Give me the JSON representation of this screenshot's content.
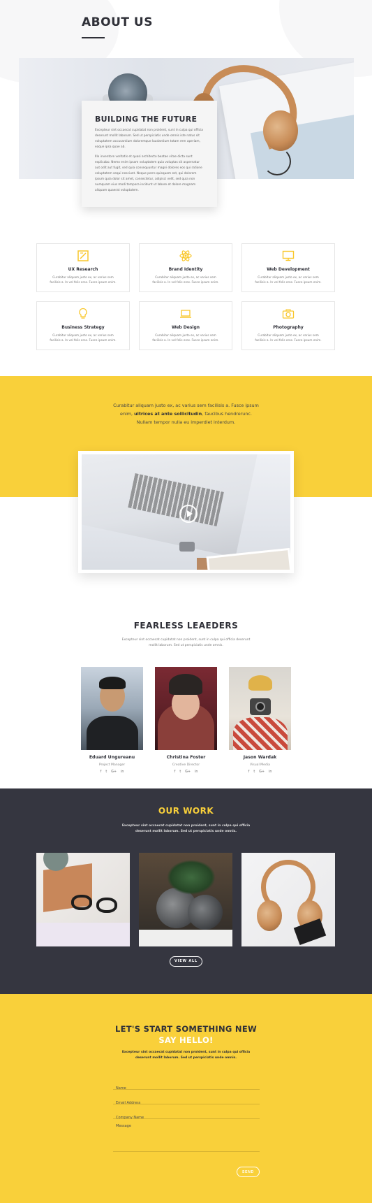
{
  "hero": {
    "title": "ABOUT US"
  },
  "intro_card": {
    "title": "BUILDING THE FUTURE",
    "paragraph1": "Excepteur sint occaecat cupidatat non proident, sunt in culpa qui officia deserunt mollit laborum. Sed ut perspiciatis unde omnis iste natus sit voluptatem accusantium doloremque laudantium totam rem aperiam, eaque ipsa quae ab.",
    "paragraph2": "Illo inventore veritatis et quasi architecto beatae vitae dicta sunt explicabo. Nemo enim ipsam voluptatem quia voluptas sit aspernatur aut odit aut fugit, sed quia consequuntur magni dolores eos qui ratione voluptatem sequi nesciunt. Neque porro quisquam est, qui dolorem ipsum quia dolor sit amet, consectetur, adipisci velit, sed quia non numquam eius modi tempora incidunt ut labore et dolore magnam aliquam quaerat voluptatem."
  },
  "services": [
    {
      "title": "UX Research",
      "text": "Curabitur aliquam justo ex, ac varius sem facilisis a. In vel felis eros. Fusce ipsum enim.",
      "icon": "pencil-square-icon"
    },
    {
      "title": "Brand Identity",
      "text": "Curabitur aliquam justo ex, ac varius sem facilisis a. In vel felis eros. Fusce ipsum enim.",
      "icon": "atom-icon"
    },
    {
      "title": "Web Development",
      "text": "Curabitur aliquam justo ex, ac varius sem facilisis a. In vel felis eros. Fusce ipsum enim.",
      "icon": "monitor-icon"
    },
    {
      "title": "Business Strategy",
      "text": "Curabitur aliquam justo ex, ac varius sem facilisis a. In vel felis eros. Fusce ipsum enim.",
      "icon": "lightbulb-icon"
    },
    {
      "title": "Web Design",
      "text": "Curabitur aliquam justo ex, ac varius sem facilisis a. In vel felis eros. Fusce ipsum enim.",
      "icon": "laptop-icon"
    },
    {
      "title": "Photography",
      "text": "Curabitur aliquam justo ex, ac varius sem facilisis a. In vel felis eros. Fusce ipsum enim.",
      "icon": "camera-icon"
    }
  ],
  "quote": {
    "part1": "Curabitur aliquam justo ex, ac varius sem facilisis a. Fusce ipsum enim, ",
    "bold": "ultrices at ante sollicitudin",
    "part2": ", faucibus hendrerunc. Nullam tempor nulla eu imperdiet interdum."
  },
  "team": {
    "title": "FEARLESS LEAEDERS",
    "subtitle": "Excepteur sint occaecat cupidatat non proident, sunt in culpa qui officia deserunt mollit laborum. Sed ut perspiciatis unde omnis.",
    "members": [
      {
        "name": "Eduard Ungureanu",
        "role": "Project Manager"
      },
      {
        "name": "Christina Foster",
        "role": "Creative Director"
      },
      {
        "name": "Jason Wardak",
        "role": "Visual Media"
      }
    ],
    "social": [
      "f",
      "t",
      "G+",
      "in"
    ]
  },
  "work": {
    "title": "OUR WORK",
    "subtitle": "Excepteur sint occaecat cupidatat non proident, sunt in culpa qui officia deserunt mollit laborum. Sed ut perspiciatis unde omnis.",
    "view_all": "VIEW ALL"
  },
  "contact": {
    "title": "LET'S START SOMETHING NEW",
    "title2": "SAY HELLO!",
    "subtitle": "Excepteur sint occaecat cupidatat non proident, sunt in culpa qui officia deserunt mollit laborum. Sed ut perspiciatis unde omnis.",
    "fields": {
      "name": "Name",
      "email": "Email Address",
      "company": "Company Name",
      "message": "Message"
    },
    "send": "SEND"
  },
  "colors": {
    "accent": "#f9d03a",
    "dark": "#353640",
    "heading": "#2f3038"
  }
}
